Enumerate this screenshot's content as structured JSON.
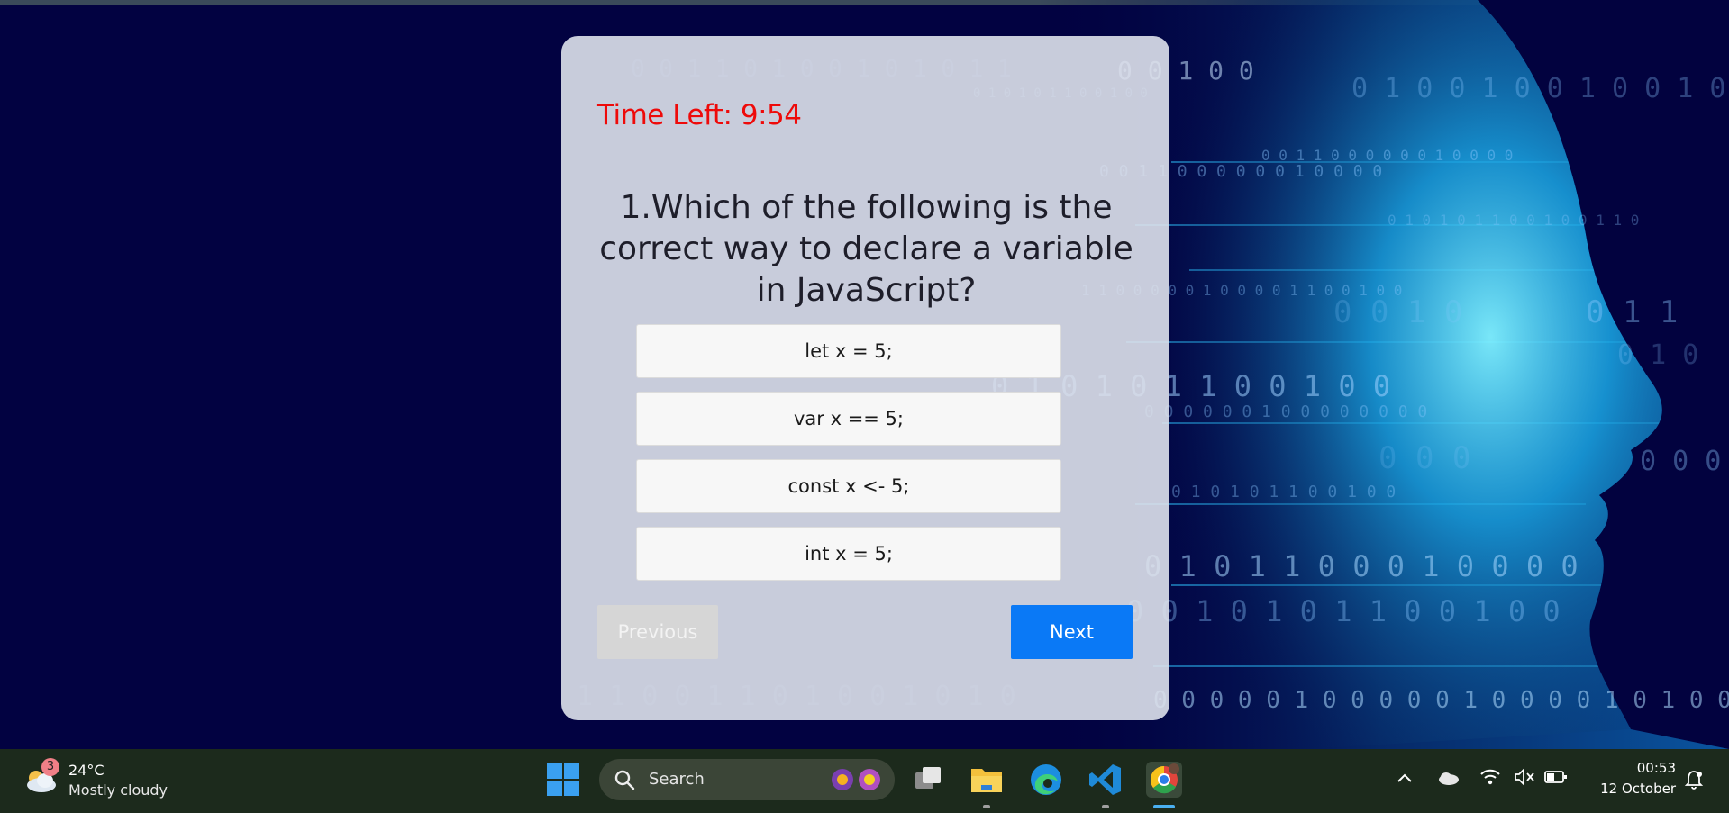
{
  "quiz": {
    "timer_label": "Time Left: 9:54",
    "question": "1.Which of the following is the correct way to declare a variable in JavaScript?",
    "answers": [
      "let x = 5;",
      "var x == 5;",
      "const x <- 5;",
      "int x = 5;"
    ],
    "previous_label": "Previous",
    "next_label": "Next"
  },
  "taskbar": {
    "weather": {
      "badge": "3",
      "temp": "24°C",
      "desc": "Mostly cloudy",
      "icon": "cloud-moon-icon"
    },
    "search_label": "Search",
    "apps": [
      "start-icon",
      "task-view-icon",
      "file-explorer-icon",
      "edge-icon",
      "vscode-icon",
      "chrome-icon"
    ],
    "clock": {
      "time": "00:53",
      "date": "12 October"
    }
  },
  "colors": {
    "background": "#020241",
    "timer": "#ee0a0a",
    "next_button": "#0a79f6",
    "previous_button": "#d6d6d6",
    "taskbar": "#1c2a1c"
  }
}
